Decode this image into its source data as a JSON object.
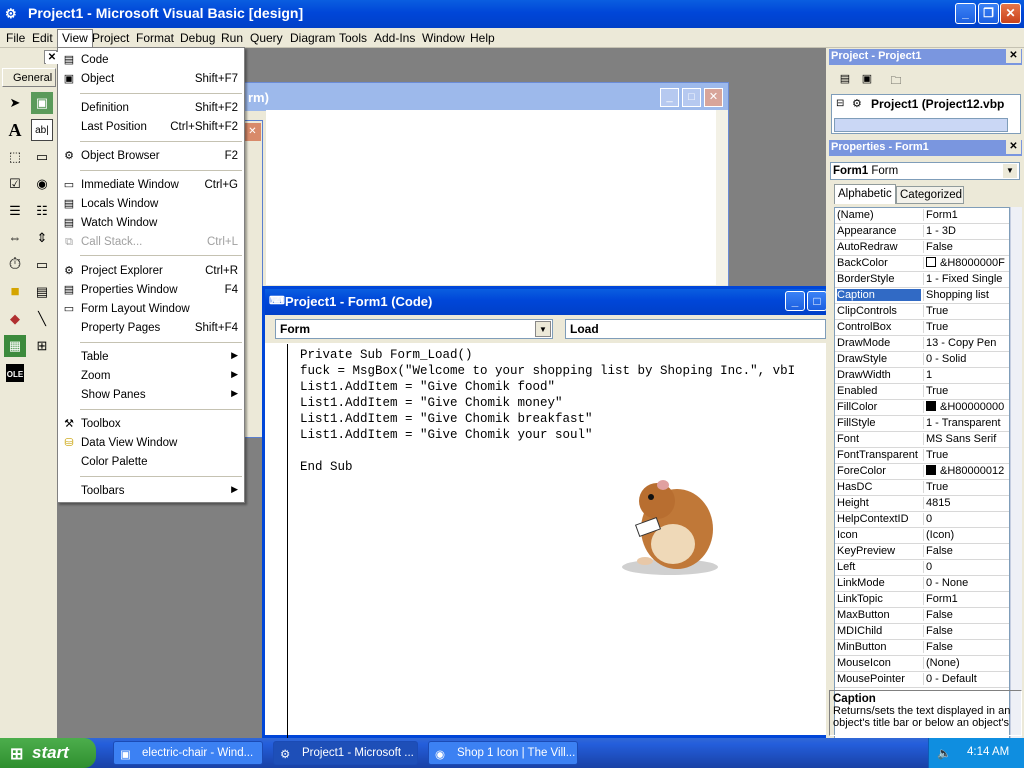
{
  "window": {
    "title": "Project1 - Microsoft Visual Basic [design]"
  },
  "menubar": [
    "File",
    "Edit",
    "View",
    "Project",
    "Format",
    "Debug",
    "Run",
    "Query",
    "Diagram",
    "Tools",
    "Add-Ins",
    "Window",
    "Help"
  ],
  "toolbox": {
    "tab": "General"
  },
  "view_menu": {
    "items": [
      {
        "label": "Code",
        "shortcut": "",
        "icon": "code-icon"
      },
      {
        "label": "Object",
        "shortcut": "Shift+F7",
        "icon": "object-icon"
      },
      {
        "label": "Definition",
        "shortcut": "Shift+F2"
      },
      {
        "label": "Last Position",
        "shortcut": "Ctrl+Shift+F2"
      },
      {
        "label": "Object Browser",
        "shortcut": "F2",
        "icon": "object-browser-icon"
      },
      {
        "label": "Immediate Window",
        "shortcut": "Ctrl+G",
        "icon": "immediate-window-icon"
      },
      {
        "label": "Locals Window",
        "shortcut": "",
        "icon": "locals-window-icon"
      },
      {
        "label": "Watch Window",
        "shortcut": "",
        "icon": "watch-window-icon"
      },
      {
        "label": "Call Stack...",
        "shortcut": "Ctrl+L",
        "icon": "call-stack-icon",
        "disabled": true
      },
      {
        "label": "Project Explorer",
        "shortcut": "Ctrl+R",
        "icon": "project-explorer-icon"
      },
      {
        "label": "Properties Window",
        "shortcut": "F4",
        "icon": "properties-window-icon"
      },
      {
        "label": "Form Layout Window",
        "shortcut": "",
        "icon": "form-layout-icon"
      },
      {
        "label": "Property Pages",
        "shortcut": "Shift+F4"
      },
      {
        "label": "Table",
        "submenu": true
      },
      {
        "label": "Zoom",
        "submenu": true
      },
      {
        "label": "Show Panes",
        "submenu": true
      },
      {
        "label": "Toolbox",
        "shortcut": "",
        "icon": "toolbox-icon"
      },
      {
        "label": "Data View Window",
        "shortcut": "",
        "icon": "data-view-icon"
      },
      {
        "label": "Color Palette",
        "shortcut": ""
      },
      {
        "label": "Toolbars",
        "submenu": true
      }
    ]
  },
  "designer": {
    "title_fragment": "rm)"
  },
  "code_window": {
    "title": "Project1 - Form1 (Code)",
    "object_combo": "Form",
    "proc_combo": "Load",
    "code": "Private Sub Form_Load()\nfuck = MsgBox(\"Welcome to your shopping list by Shoping Inc.\", vbI\nList1.AddItem = \"Give Chomik food\"\nList1.AddItem = \"Give Chomik money\"\nList1.AddItem = \"Give Chomik breakfast\"\nList1.AddItem = \"Give Chomik your soul\"\n\nEnd Sub"
  },
  "project_panel": {
    "title": "Project - Project1",
    "tree_item": "Project1 (Project12.vbp"
  },
  "properties_panel": {
    "title": "Properties - Form1",
    "object_name": "Form1",
    "object_type": "Form",
    "tabs": [
      "Alphabetic",
      "Categorized"
    ],
    "rows": [
      {
        "name": "(Name)",
        "value": "Form1"
      },
      {
        "name": "Appearance",
        "value": "1 - 3D"
      },
      {
        "name": "AutoRedraw",
        "value": "False"
      },
      {
        "name": "BackColor",
        "value": "&H8000000F",
        "swatch": "#ffffff"
      },
      {
        "name": "BorderStyle",
        "value": "1 - Fixed Single"
      },
      {
        "name": "Caption",
        "value": "Shopping list",
        "selected": true
      },
      {
        "name": "ClipControls",
        "value": "True"
      },
      {
        "name": "ControlBox",
        "value": "True"
      },
      {
        "name": "DrawMode",
        "value": "13 - Copy Pen"
      },
      {
        "name": "DrawStyle",
        "value": "0 - Solid"
      },
      {
        "name": "DrawWidth",
        "value": "1"
      },
      {
        "name": "Enabled",
        "value": "True"
      },
      {
        "name": "FillColor",
        "value": "&H00000000",
        "swatch": "#000000"
      },
      {
        "name": "FillStyle",
        "value": "1 - Transparent"
      },
      {
        "name": "Font",
        "value": "MS Sans Serif"
      },
      {
        "name": "FontTransparent",
        "value": "True"
      },
      {
        "name": "ForeColor",
        "value": "&H80000012",
        "swatch": "#000000"
      },
      {
        "name": "HasDC",
        "value": "True"
      },
      {
        "name": "Height",
        "value": "4815"
      },
      {
        "name": "HelpContextID",
        "value": "0"
      },
      {
        "name": "Icon",
        "value": "(Icon)"
      },
      {
        "name": "KeyPreview",
        "value": "False"
      },
      {
        "name": "Left",
        "value": "0"
      },
      {
        "name": "LinkMode",
        "value": "0 - None"
      },
      {
        "name": "LinkTopic",
        "value": "Form1"
      },
      {
        "name": "MaxButton",
        "value": "False"
      },
      {
        "name": "MDIChild",
        "value": "False"
      },
      {
        "name": "MinButton",
        "value": "False"
      },
      {
        "name": "MouseIcon",
        "value": "(None)"
      },
      {
        "name": "MousePointer",
        "value": "0 - Default"
      }
    ],
    "desc_title": "Caption",
    "desc_text": "Returns/sets the text displayed in an object's title bar or below an object's"
  },
  "taskbar": {
    "start": "start",
    "tasks": [
      {
        "label": "electric-chair - Wind..."
      },
      {
        "label": "Project1 - Microsoft ...",
        "active": true
      },
      {
        "label": "Shop 1 Icon | The Vill..."
      }
    ],
    "clock": "4:14 AM"
  }
}
